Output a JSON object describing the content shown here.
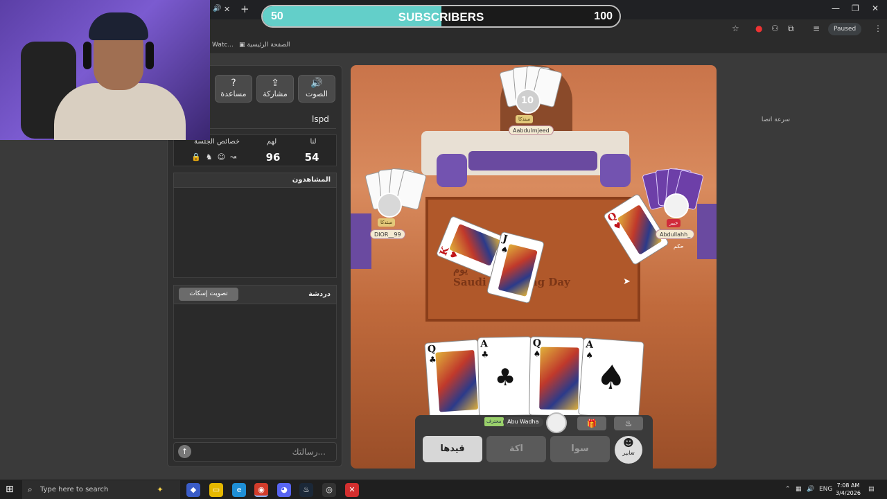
{
  "browser": {
    "tab_fragment": "Watc...",
    "bookmark": "الصفحة الرئيسية",
    "paused_label": "Paused"
  },
  "subscribers": {
    "start": "50",
    "title": "SUBSCRIBERS",
    "end": "100",
    "progress": 0.5
  },
  "panel": {
    "buttons": {
      "sound": "الصوت",
      "share": "مشاركة",
      "help": "مساعدة"
    },
    "speed_label": "سرعة اتصا",
    "speed_value": "lspd",
    "score": {
      "us_label": "لنا",
      "them_label": "لهم",
      "session_label": "خصائص الجلسة",
      "us_value": "54",
      "them_value": "96"
    },
    "watchers_label": "المشاهدون",
    "chat_label": "دردشة",
    "mute_vote_label": "تصويت إسكات",
    "message_placeholder": "رسالتك..."
  },
  "game": {
    "players": {
      "top": {
        "name": "Aabdulmjeed",
        "tag": "مبتدكا",
        "count": "10"
      },
      "left": {
        "name": "DIOR__99",
        "tag": "مبتدكا"
      },
      "right": {
        "name": "Abdullahh_",
        "tag": "خبير",
        "role": "حكم"
      },
      "me": {
        "name": "Abu Wadha",
        "tag": "محترف"
      }
    },
    "table_text": "Saudi Founding Day",
    "table_text_ar": "يوم",
    "hand": [
      {
        "rank": "Q",
        "suit": "♣",
        "color": "black"
      },
      {
        "rank": "A",
        "suit": "♣",
        "color": "black"
      },
      {
        "rank": "Q",
        "suit": "♠",
        "color": "black"
      },
      {
        "rank": "A",
        "suit": "♠",
        "color": "black"
      }
    ],
    "played": [
      {
        "rank": "K",
        "suit": "♥",
        "color": "red"
      },
      {
        "rank": "J",
        "suit": "♠",
        "color": "black"
      },
      {
        "rank": "Q",
        "suit": "♥",
        "color": "red"
      }
    ],
    "actions": {
      "qaydha": "قيدها",
      "akka": "اكة",
      "sawa": "سوا",
      "emotes": "تعابير"
    }
  },
  "taskbar": {
    "search_placeholder": "Type here to search",
    "lang": "ENG",
    "time": "7:08 AM",
    "date": "3/4/2026"
  }
}
